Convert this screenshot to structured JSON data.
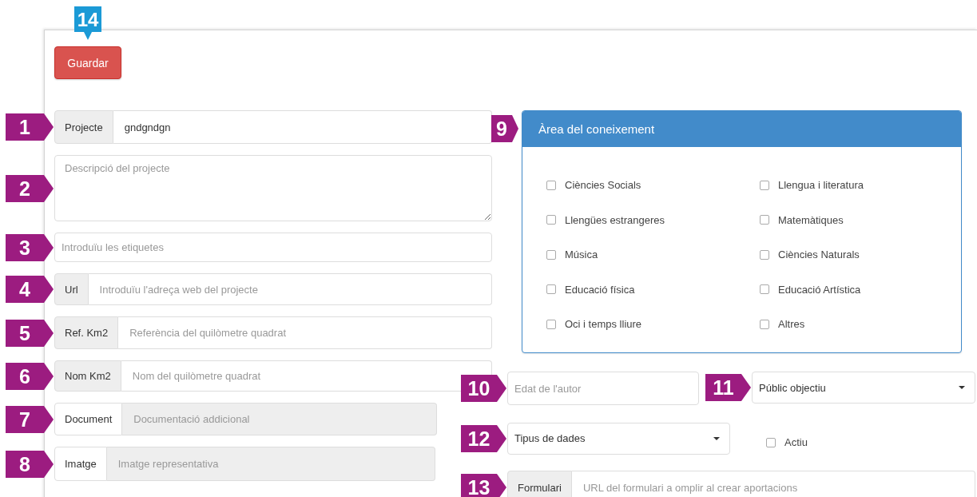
{
  "save_button": {
    "label": "Guardar",
    "marker": "14"
  },
  "left_fields": [
    {
      "kind": "addon",
      "marker": "1",
      "addon": "Projecte",
      "value": "gndgndgn",
      "disabled": false
    },
    {
      "kind": "textarea",
      "marker": "2",
      "placeholder": "Descripció del projecte"
    },
    {
      "kind": "input",
      "marker": "3",
      "placeholder": "Introduïu les etiquetes"
    },
    {
      "kind": "addon",
      "marker": "4",
      "addon": "Url",
      "placeholder": "Introduïu l'adreça web del projecte",
      "disabled": false
    },
    {
      "kind": "addon",
      "marker": "5",
      "addon": "Ref. Km2",
      "placeholder": "Referència del quilòmetre quadrat",
      "disabled": false
    },
    {
      "kind": "addon",
      "marker": "6",
      "addon": "Nom Km2",
      "placeholder": "Nom del quilòmetre quadrat",
      "disabled": false
    },
    {
      "kind": "addon",
      "marker": "7",
      "addon": "Document",
      "placeholder": "Documentació addicional",
      "disabled": true
    },
    {
      "kind": "addon",
      "marker": "8",
      "addon": "Imatge",
      "placeholder": "Imatge representativa",
      "disabled": true
    }
  ],
  "knowledge_panel": {
    "marker": "9",
    "title": "Àrea del coneixement",
    "options": [
      {
        "label": "Ciències Socials",
        "checked": false
      },
      {
        "label": "Llengua i literatura",
        "checked": false
      },
      {
        "label": "Llengües estrangeres",
        "checked": false
      },
      {
        "label": "Matemàtiques",
        "checked": false
      },
      {
        "label": "Música",
        "checked": false
      },
      {
        "label": "Ciències Naturals",
        "checked": false
      },
      {
        "label": "Educació física",
        "checked": false
      },
      {
        "label": "Educació Artística",
        "checked": false
      },
      {
        "label": "Oci i temps lliure",
        "checked": false
      },
      {
        "label": "Altres",
        "checked": false
      }
    ]
  },
  "author_age": {
    "marker": "10",
    "placeholder": "Edat de l'autor"
  },
  "audience_select": {
    "marker": "11",
    "value": "Públic objectiu"
  },
  "data_type_select": {
    "marker": "12",
    "value": "Tipus de dades"
  },
  "active_checkbox": {
    "label": "Actiu",
    "checked": false
  },
  "form_url": {
    "marker": "13",
    "addon": "Formulari",
    "placeholder": "URL del formulari a omplir al crear aportacions"
  }
}
